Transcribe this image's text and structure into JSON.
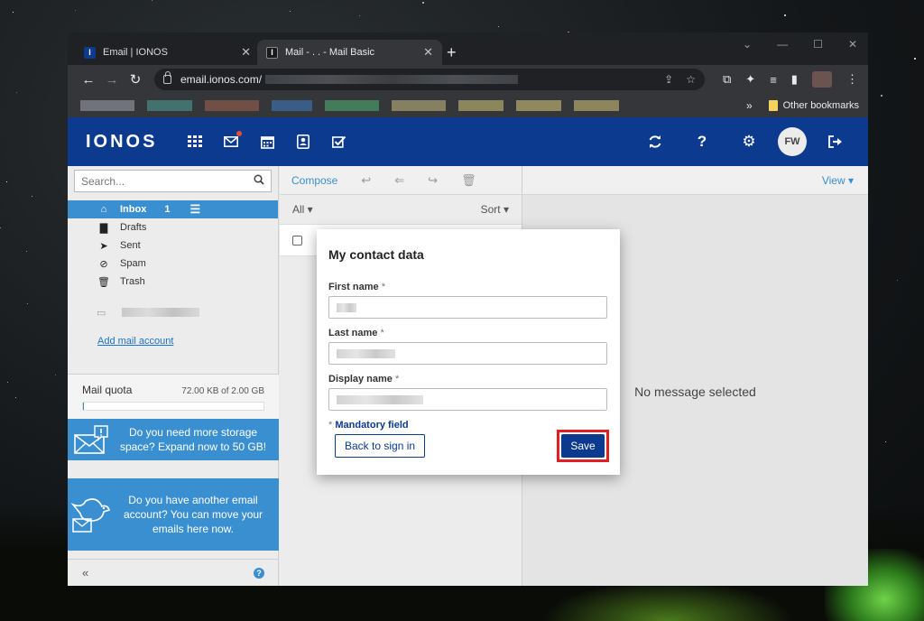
{
  "browser": {
    "tabs": [
      {
        "title": "Email | IONOS",
        "favicon": "I"
      },
      {
        "title": "Mail - . . - Mail Basic",
        "favicon": "I"
      }
    ],
    "address": "email.ionos.com/",
    "other_bookmarks": "Other bookmarks"
  },
  "app": {
    "logo": "IONOS",
    "avatar_initials": "FW",
    "search_placeholder": "Search...",
    "folders": [
      {
        "icon": "inbox-icon",
        "label": "Inbox",
        "count": "1"
      },
      {
        "icon": "file-icon",
        "label": "Drafts"
      },
      {
        "icon": "send-icon",
        "label": "Sent"
      },
      {
        "icon": "spam-icon",
        "label": "Spam"
      },
      {
        "icon": "trash-icon",
        "label": "Trash"
      }
    ],
    "add_mail_account": "Add mail account",
    "quota": {
      "label": "Mail quota",
      "value": "72.00 KB of 2.00 GB",
      "fraction": 4e-05
    },
    "promo_storage": "Do you need more storage space? Expand now to 50 GB!",
    "promo_move": "Do you have another email account? You can move your emails here now.",
    "collapse_symbol": "«",
    "list_toolbar": {
      "compose": "Compose"
    },
    "list_filter": {
      "all": "All ▾",
      "sort": "Sort ▾"
    },
    "view_label": "View ▾",
    "no_message": "No message selected"
  },
  "modal": {
    "title": "My contact data",
    "first_name_label": "First name",
    "last_name_label": "Last name",
    "display_name_label": "Display name",
    "required_mark": "*",
    "mandatory_text": "Mandatory field",
    "back_button": "Back to sign in",
    "save_button": "Save"
  },
  "colors": {
    "brand": "#0b3a8f",
    "accent": "#3a8fd0",
    "highlight": "#e01e24"
  }
}
